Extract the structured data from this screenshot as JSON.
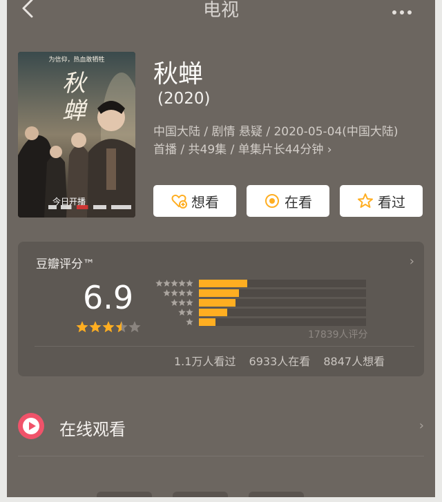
{
  "header": {
    "title": "电视",
    "back_icon": "chevron-left-icon",
    "more_icon": "more-dots-icon"
  },
  "poster": {
    "tagline": "为信仰，热血敢牺牲",
    "title": "秋蝉",
    "air_text": "今日开播"
  },
  "show": {
    "name": "秋蝉",
    "year": "(2020)",
    "meta_line1": "中国大陆 / 剧情 悬疑 / 2020-05-04(中国大陆)",
    "meta_line2": "首播 / 共49集 / 单集片长44分钟 ›"
  },
  "actions": [
    {
      "label": "想看",
      "icon": "heart-plus-icon"
    },
    {
      "label": "在看",
      "icon": "circle-dot-icon"
    },
    {
      "label": "看过",
      "icon": "star-outline-icon"
    }
  ],
  "rating": {
    "title": "豆瓣评分™",
    "score": "6.9",
    "stars": 3.5,
    "star_color": "#ffae21",
    "distribution": [
      {
        "stars": 5,
        "fraction": 0.29
      },
      {
        "stars": 4,
        "fraction": 0.24
      },
      {
        "stars": 3,
        "fraction": 0.22
      },
      {
        "stars": 2,
        "fraction": 0.17
      },
      {
        "stars": 1,
        "fraction": 0.1
      }
    ],
    "count_text": "17839人评分",
    "stats": [
      "1.1万人看过",
      "6933人在看",
      "8847人想看"
    ]
  },
  "online": {
    "label": "在线观看",
    "icon": "play-circle-icon",
    "icon_color": "#f0536a"
  }
}
